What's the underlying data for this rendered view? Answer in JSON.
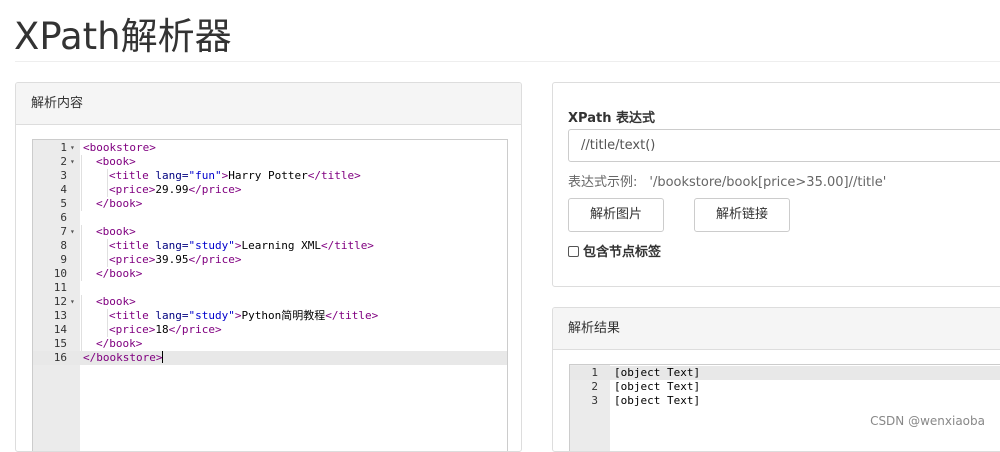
{
  "page": {
    "title": "XPath解析器"
  },
  "content_panel": {
    "heading": "解析内容",
    "lines": [
      {
        "n": "1",
        "fold": "▾",
        "indent": 0,
        "tokens": [
          [
            "tag",
            "<bookstore>"
          ]
        ]
      },
      {
        "n": "2",
        "fold": "▾",
        "indent": 1,
        "tokens": [
          [
            "tag",
            "<book>"
          ]
        ]
      },
      {
        "n": "3",
        "fold": "",
        "indent": 2,
        "tokens": [
          [
            "tag",
            "<title "
          ],
          [
            "attr",
            "lang="
          ],
          [
            "str",
            "\"fun\""
          ],
          [
            "tag",
            ">"
          ],
          [
            "txt",
            "Harry Potter"
          ],
          [
            "tag",
            "</title>"
          ]
        ]
      },
      {
        "n": "4",
        "fold": "",
        "indent": 2,
        "tokens": [
          [
            "tag",
            "<price>"
          ],
          [
            "txt",
            "29.99"
          ],
          [
            "tag",
            "</price>"
          ]
        ]
      },
      {
        "n": "5",
        "fold": "",
        "indent": 1,
        "tokens": [
          [
            "tag",
            "</book>"
          ]
        ]
      },
      {
        "n": "6",
        "fold": "",
        "indent": 0,
        "tokens": []
      },
      {
        "n": "7",
        "fold": "▾",
        "indent": 1,
        "tokens": [
          [
            "tag",
            "<book>"
          ]
        ]
      },
      {
        "n": "8",
        "fold": "",
        "indent": 2,
        "tokens": [
          [
            "tag",
            "<title "
          ],
          [
            "attr",
            "lang="
          ],
          [
            "str",
            "\"study\""
          ],
          [
            "tag",
            ">"
          ],
          [
            "txt",
            "Learning XML"
          ],
          [
            "tag",
            "</title>"
          ]
        ]
      },
      {
        "n": "9",
        "fold": "",
        "indent": 2,
        "tokens": [
          [
            "tag",
            "<price>"
          ],
          [
            "txt",
            "39.95"
          ],
          [
            "tag",
            "</price>"
          ]
        ]
      },
      {
        "n": "10",
        "fold": "",
        "indent": 1,
        "tokens": [
          [
            "tag",
            "</book>"
          ]
        ]
      },
      {
        "n": "11",
        "fold": "",
        "indent": 0,
        "tokens": []
      },
      {
        "n": "12",
        "fold": "▾",
        "indent": 1,
        "tokens": [
          [
            "tag",
            "<book>"
          ]
        ]
      },
      {
        "n": "13",
        "fold": "",
        "indent": 2,
        "tokens": [
          [
            "tag",
            "<title "
          ],
          [
            "attr",
            "lang="
          ],
          [
            "str",
            "\"study\""
          ],
          [
            "tag",
            ">"
          ],
          [
            "txt",
            "Python简明教程"
          ],
          [
            "tag",
            "</title>"
          ]
        ]
      },
      {
        "n": "14",
        "fold": "",
        "indent": 2,
        "tokens": [
          [
            "tag",
            "<price>"
          ],
          [
            "txt",
            "18"
          ],
          [
            "tag",
            "</price>"
          ]
        ]
      },
      {
        "n": "15",
        "fold": "",
        "indent": 1,
        "tokens": [
          [
            "tag",
            "</book>"
          ]
        ]
      },
      {
        "n": "16",
        "fold": "",
        "indent": 0,
        "tokens": [
          [
            "tag",
            "</bookstore>"
          ]
        ],
        "active": true
      }
    ]
  },
  "expr_panel": {
    "label": "XPath 表达式",
    "input_value": "//title/text()",
    "example_label": "表达式示例:",
    "example_value": "'/bookstore/book[price>35.00]//title'",
    "parse_images_label": "解析图片",
    "parse_links_label": "解析链接",
    "include_tags_label": "包含节点标签",
    "include_tags_checked": false
  },
  "result_panel": {
    "heading": "解析结果",
    "lines": [
      {
        "n": "1",
        "text": "[object Text]",
        "active": true
      },
      {
        "n": "2",
        "text": "[object Text]"
      },
      {
        "n": "3",
        "text": "[object Text]"
      }
    ]
  },
  "watermark": "CSDN @wenxiaoba",
  "colors": {
    "tag": "#800080",
    "attr": "#000080",
    "string": "#0000cc",
    "gutter": "#ebebeb"
  }
}
